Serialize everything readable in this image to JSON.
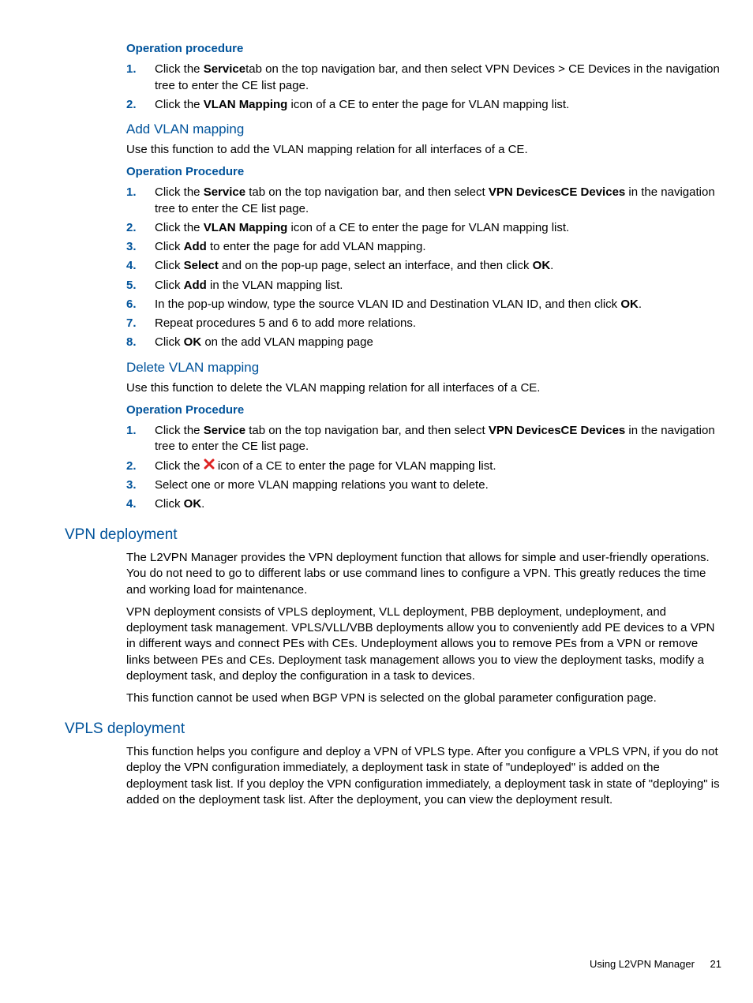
{
  "sec1": {
    "h4": "Operation procedure",
    "steps": [
      {
        "n": "1.",
        "pre": "Click the ",
        "b": "Service",
        "post": "tab on the top navigation bar, and then select VPN Devices > CE Devices in the navigation tree to enter the CE list page."
      },
      {
        "n": "2.",
        "pre": "Click the ",
        "b": "VLAN Mapping",
        "post": " icon of a CE to enter the page for VLAN mapping list."
      }
    ]
  },
  "sec2": {
    "h3": "Add VLAN mapping",
    "intro": "Use this function to add the VLAN mapping relation for all interfaces of a CE.",
    "h4": "Operation Procedure",
    "steps": [
      {
        "n": "1.",
        "pre": "Click the ",
        "b": "Service",
        "post": " tab on the top navigation bar, and then select ",
        "b2": "VPN DevicesCE Devices",
        "post2": " in the navigation tree to enter the CE list page."
      },
      {
        "n": "2.",
        "pre": "Click the ",
        "b": "VLAN Mapping",
        "post": " icon of a CE to enter the page for VLAN mapping list."
      },
      {
        "n": "3.",
        "pre": "Click ",
        "b": "Add",
        "post": " to enter the page for add VLAN mapping."
      },
      {
        "n": "4.",
        "pre": "Click ",
        "b": "Select",
        "post": " and on the pop-up page, select an interface, and then click ",
        "b2": "OK",
        "post2": "."
      },
      {
        "n": "5.",
        "pre": "Click ",
        "b": "Add",
        "post": " in the VLAN mapping list."
      },
      {
        "n": "6.",
        "pre": "In the pop-up window, type the source VLAN ID and Destination VLAN ID, and then click ",
        "b": "OK",
        "post": "."
      },
      {
        "n": "7.",
        "pre": "Repeat procedures 5 and 6 to add more relations.",
        "b": "",
        "post": ""
      },
      {
        "n": "8.",
        "pre": "Click ",
        "b": "OK",
        "post": " on the add VLAN mapping page"
      }
    ]
  },
  "sec3": {
    "h3": "Delete VLAN mapping",
    "intro": "Use this function to delete the VLAN mapping relation for all interfaces of a CE.",
    "h4": "Operation Procedure",
    "steps": [
      {
        "n": "1.",
        "pre": "Click the ",
        "b": "Service",
        "post": " tab on the top navigation bar, and then select ",
        "b2": "VPN DevicesCE Devices",
        "post2": " in the navigation tree to enter the CE list page."
      },
      {
        "n": "2.",
        "pre": "Click the ",
        "icon": true,
        "post": " icon of a CE to enter the page for VLAN mapping list."
      },
      {
        "n": "3.",
        "pre": "Select one or more VLAN mapping relations you want to delete.",
        "b": "",
        "post": ""
      },
      {
        "n": "4.",
        "pre": "Click ",
        "b": "OK",
        "post": "."
      }
    ]
  },
  "sec4": {
    "h2": "VPN deployment",
    "paras": [
      "The L2VPN Manager provides the VPN deployment function that allows for simple and user-friendly operations. You do not need to go to different labs or use command lines to configure a VPN. This greatly reduces the time and working load for maintenance.",
      "VPN deployment consists of VPLS deployment, VLL deployment, PBB deployment, undeployment, and deployment task management. VPLS/VLL/VBB deployments allow you to conveniently add PE devices to a VPN in different ways and connect PEs with CEs. Undeployment allows you to remove PEs from a VPN or remove links between PEs and CEs. Deployment task management allows you to view the deployment tasks, modify a deployment task, and deploy the configuration in a task to devices.",
      "This function cannot be used when BGP VPN is selected on the global parameter configuration page."
    ]
  },
  "sec5": {
    "h2": "VPLS deployment",
    "paras": [
      "This function helps you configure and deploy a VPN of VPLS type. After you configure a VPLS VPN, if you do not deploy the VPN configuration immediately, a deployment task in state of \"undeployed\" is added on the deployment task list. If you deploy the VPN configuration immediately, a deployment task in state of \"deploying\" is added on the deployment task list. After the deployment, you can view the deployment result."
    ]
  },
  "footer": {
    "label": "Using L2VPN Manager",
    "page": "21"
  }
}
